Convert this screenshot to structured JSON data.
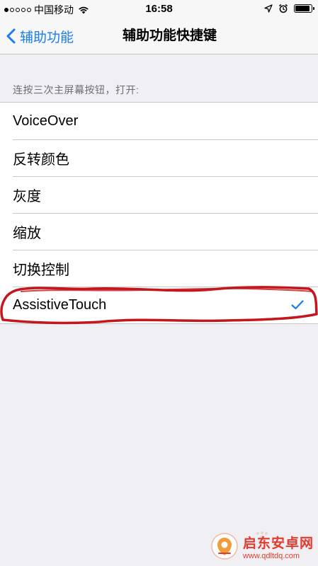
{
  "status_bar": {
    "carrier": "中国移动",
    "time": "16:58",
    "signal_strength": "1-of-5",
    "icons": [
      "wifi-icon",
      "location-arrow-icon",
      "alarm-icon",
      "battery-icon"
    ],
    "battery_level": 0.9
  },
  "nav": {
    "back_label": "辅助功能",
    "title": "辅助功能快捷键"
  },
  "section_header": "连按三次主屏幕按钮，打开:",
  "options": [
    {
      "label": "VoiceOver",
      "selected": false
    },
    {
      "label": "反转颜色",
      "selected": false
    },
    {
      "label": "灰度",
      "selected": false
    },
    {
      "label": "缩放",
      "selected": false
    },
    {
      "label": "切换控制",
      "selected": false
    },
    {
      "label": "AssistiveTouch",
      "selected": true
    }
  ],
  "colors": {
    "accent": "#1a7cf2",
    "background": "#efeff4",
    "annotation": "#c4161c",
    "watermark": "#e23b2e"
  },
  "watermark": {
    "name": "启东安卓网",
    "url": "www.qdltdq.com"
  }
}
